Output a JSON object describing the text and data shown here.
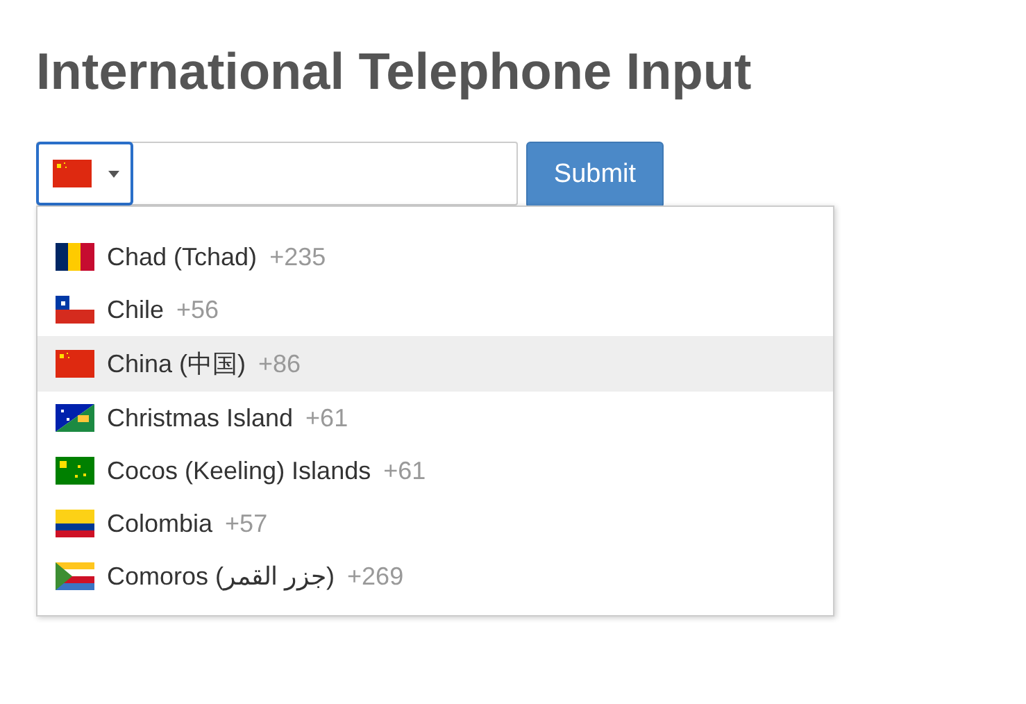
{
  "title": "International Telephone Input",
  "phone_input": {
    "dropdown_open": true
  },
  "submit_button": "Submit",
  "countries": [
    {
      "name": "Chad (Tchad)",
      "dial_code": "+235",
      "highlighted": false
    },
    {
      "name": "Chile",
      "dial_code": "+56",
      "highlighted": false
    },
    {
      "name": "China (中国)",
      "dial_code": "+86",
      "highlighted": true
    },
    {
      "name": "Christmas Island",
      "dial_code": "+61",
      "highlighted": false
    },
    {
      "name": "Cocos (Keeling) Islands",
      "dial_code": "+61",
      "highlighted": false
    },
    {
      "name": "Colombia",
      "dial_code": "+57",
      "highlighted": false
    },
    {
      "name": "Comoros (جزر القمر)",
      "dial_code": "+269",
      "highlighted": false
    }
  ]
}
